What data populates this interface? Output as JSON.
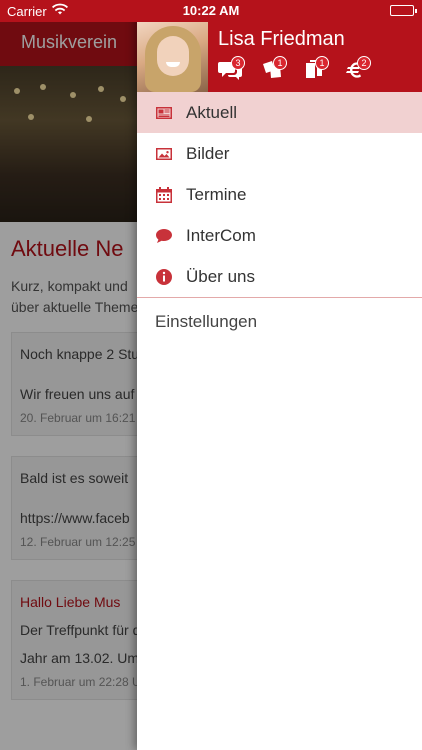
{
  "status_bar": {
    "carrier": "Carrier",
    "time": "10:22 AM"
  },
  "background": {
    "nav_title": "Musikverein",
    "heading": "Aktuelle Ne",
    "intro_line1": "Kurz, kompakt und",
    "intro_line2": "über aktuelle Theme",
    "cards": [
      {
        "title": "",
        "line1": "Noch knappe 2 Stu",
        "line2": "Wir freuen uns auf",
        "date": "20. Februar um 16:21"
      },
      {
        "title": "",
        "line1": "Bald ist es soweit",
        "line2": "https://www.faceb",
        "date": "12. Februar um 12:25"
      },
      {
        "title": "Hallo Liebe Mus",
        "line1": "Der Treffpunkt für d",
        "line2": "Jahr am 13.02. Um",
        "date": "1. Februar um 22:28 U"
      }
    ]
  },
  "drawer": {
    "user_name": "Lisa Friedman",
    "header_icons": [
      {
        "icon": "chat-bubbles-icon",
        "badge": "3"
      },
      {
        "icon": "cards-icon",
        "badge": "1"
      },
      {
        "icon": "documents-icon",
        "badge": "1"
      },
      {
        "icon": "euro-icon",
        "badge": "2"
      }
    ],
    "menu": [
      {
        "icon": "newspaper-icon",
        "label": "Aktuell",
        "active": true
      },
      {
        "icon": "image-icon",
        "label": "Bilder",
        "active": false
      },
      {
        "icon": "calendar-icon",
        "label": "Termine",
        "active": false
      },
      {
        "icon": "speech-bubble-icon",
        "label": "InterCom",
        "active": false
      },
      {
        "icon": "info-icon",
        "label": "Über uns",
        "active": false
      }
    ],
    "settings_label": "Einstellungen"
  },
  "colors": {
    "brand": "#b5121b",
    "active_row": "#f1d1d1",
    "badge": "#d9262f"
  }
}
